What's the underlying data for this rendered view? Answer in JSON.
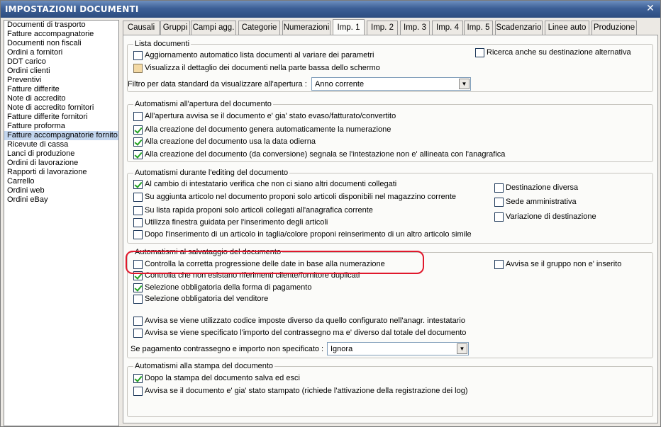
{
  "window": {
    "title": "IMPOSTAZIONI DOCUMENTI",
    "close_icon": "close-icon"
  },
  "sidebar": {
    "items": [
      {
        "label": "Documenti di trasporto",
        "selected": false
      },
      {
        "label": "Fatture accompagnatorie",
        "selected": false
      },
      {
        "label": "Documenti non fiscali",
        "selected": false
      },
      {
        "label": "Ordini a fornitori",
        "selected": false
      },
      {
        "label": "DDT carico",
        "selected": false
      },
      {
        "label": "Ordini clienti",
        "selected": false
      },
      {
        "label": "Preventivi",
        "selected": false
      },
      {
        "label": "Fatture differite",
        "selected": false
      },
      {
        "label": "Note di accredito",
        "selected": false
      },
      {
        "label": "Note di accredito fornitori",
        "selected": false
      },
      {
        "label": "Fatture differite fornitori",
        "selected": false
      },
      {
        "label": "Fatture proforma",
        "selected": false
      },
      {
        "label": "Fatture accompagnatorie fornito",
        "selected": true
      },
      {
        "label": "Ricevute di cassa",
        "selected": false
      },
      {
        "label": "Lanci di produzione",
        "selected": false
      },
      {
        "label": "Ordini di lavorazione",
        "selected": false
      },
      {
        "label": "Rapporti di lavorazione",
        "selected": false
      },
      {
        "label": "Carrello",
        "selected": false
      },
      {
        "label": "Ordini web",
        "selected": false
      },
      {
        "label": "Ordini eBay",
        "selected": false
      }
    ]
  },
  "tabs": [
    {
      "label": "Causali",
      "active": false
    },
    {
      "label": "Gruppi",
      "active": false
    },
    {
      "label": "Campi agg.",
      "active": false
    },
    {
      "label": "Categorie",
      "active": false
    },
    {
      "label": "Numerazioni",
      "active": false
    },
    {
      "label": "Imp. 1",
      "active": true
    },
    {
      "label": "Imp. 2",
      "active": false
    },
    {
      "label": "Imp. 3",
      "active": false
    },
    {
      "label": "Imp. 4",
      "active": false
    },
    {
      "label": "Imp. 5",
      "active": false
    },
    {
      "label": "Scadenzario",
      "active": false
    },
    {
      "label": "Linee auto",
      "active": false
    },
    {
      "label": "Produzione",
      "active": false
    }
  ],
  "lista": {
    "title": "Lista documenti",
    "cb1": {
      "label": "Aggiornamento automatico lista documenti al variare dei parametri",
      "checked": false
    },
    "cb2": {
      "label": "Visualizza il dettaglio dei documenti nella parte bassa dello schermo",
      "checked": false
    },
    "cb3": {
      "label": "Ricerca anche su destinazione alternativa",
      "checked": false
    },
    "filter_label": "Filtro per data standard da visualizzare all'apertura :",
    "filter_value": "Anno corrente"
  },
  "apertura": {
    "title": "Automatismi all'apertura del documento",
    "cb1": {
      "label": "All'apertura avvisa se il documento e' gia' stato evaso/fatturato/convertito",
      "checked": false
    },
    "cb2": {
      "label": "Alla creazione del documento genera automaticamente la numerazione",
      "checked": true
    },
    "cb3": {
      "label": "Alla creazione del documento usa la data odierna",
      "checked": true
    },
    "cb4": {
      "label": "Alla creazione del documento (da conversione) segnala se l'intestazione non e' allineata con l'anagrafica",
      "checked": true
    }
  },
  "editing": {
    "title": "Automatismi durante l'editing del documento",
    "cb1": {
      "label": "Al cambio di intestatario verifica che non ci siano altri documenti collegati",
      "checked": true
    },
    "cb2": {
      "label": "Su aggiunta articolo nel documento proponi solo articoli disponibili nel magazzino corrente",
      "checked": false
    },
    "cb3": {
      "label": "Su lista rapida proponi solo articoli collegati all'anagrafica corrente",
      "checked": false
    },
    "cb4": {
      "label": "Utilizza finestra guidata per l'inserimento degli articoli",
      "checked": false
    },
    "cb5": {
      "label": "Dopo l'inserimento di un articolo in taglia/colore proponi reinserimento di un altro articolo simile",
      "checked": false
    },
    "cb6": {
      "label": "Destinazione diversa",
      "checked": false
    },
    "cb7": {
      "label": "Sede amministrativa",
      "checked": false
    },
    "cb8": {
      "label": "Variazione di destinazione",
      "checked": false
    }
  },
  "salvataggio": {
    "title": "Automatismi al salvataggio del documento",
    "cb1": {
      "label": "Controlla la corretta progressione delle date in base alla numerazione",
      "checked": false
    },
    "cb2": {
      "label": "Controlla che non esistano riferimenti cliente/fornitore duplicati",
      "checked": true
    },
    "cb3": {
      "label": "Selezione obbligatoria della forma di pagamento",
      "checked": true
    },
    "cb4": {
      "label": "Selezione obbligatoria del venditore",
      "checked": false
    },
    "cb5": {
      "label": "Avvisa se viene utilizzato codice imposte diverso da quello configurato nell'anagr. intestatario",
      "checked": false
    },
    "cb6": {
      "label": "Avvisa se viene specificato l'importo del contrassegno ma e' diverso dal totale del documento",
      "checked": false
    },
    "cb7": {
      "label": "Avvisa se il gruppo non e' inserito",
      "checked": false
    },
    "contrassegno_label": "Se pagamento contrassegno e importo non specificato :",
    "contrassegno_value": "Ignora"
  },
  "stampa": {
    "title": "Automatismi alla stampa del documento",
    "cb1": {
      "label": "Dopo la stampa del documento salva ed esci",
      "checked": true
    },
    "cb2": {
      "label": "Avvisa se il documento e' gia' stato stampato (richiede l'attivazione della registrazione dei log)",
      "checked": false
    }
  },
  "colors": {
    "title_bar": "#3c5f96",
    "selection": "#c3d6ee",
    "highlight_annotation": "#e0182c",
    "checkmark": "#21a121"
  }
}
